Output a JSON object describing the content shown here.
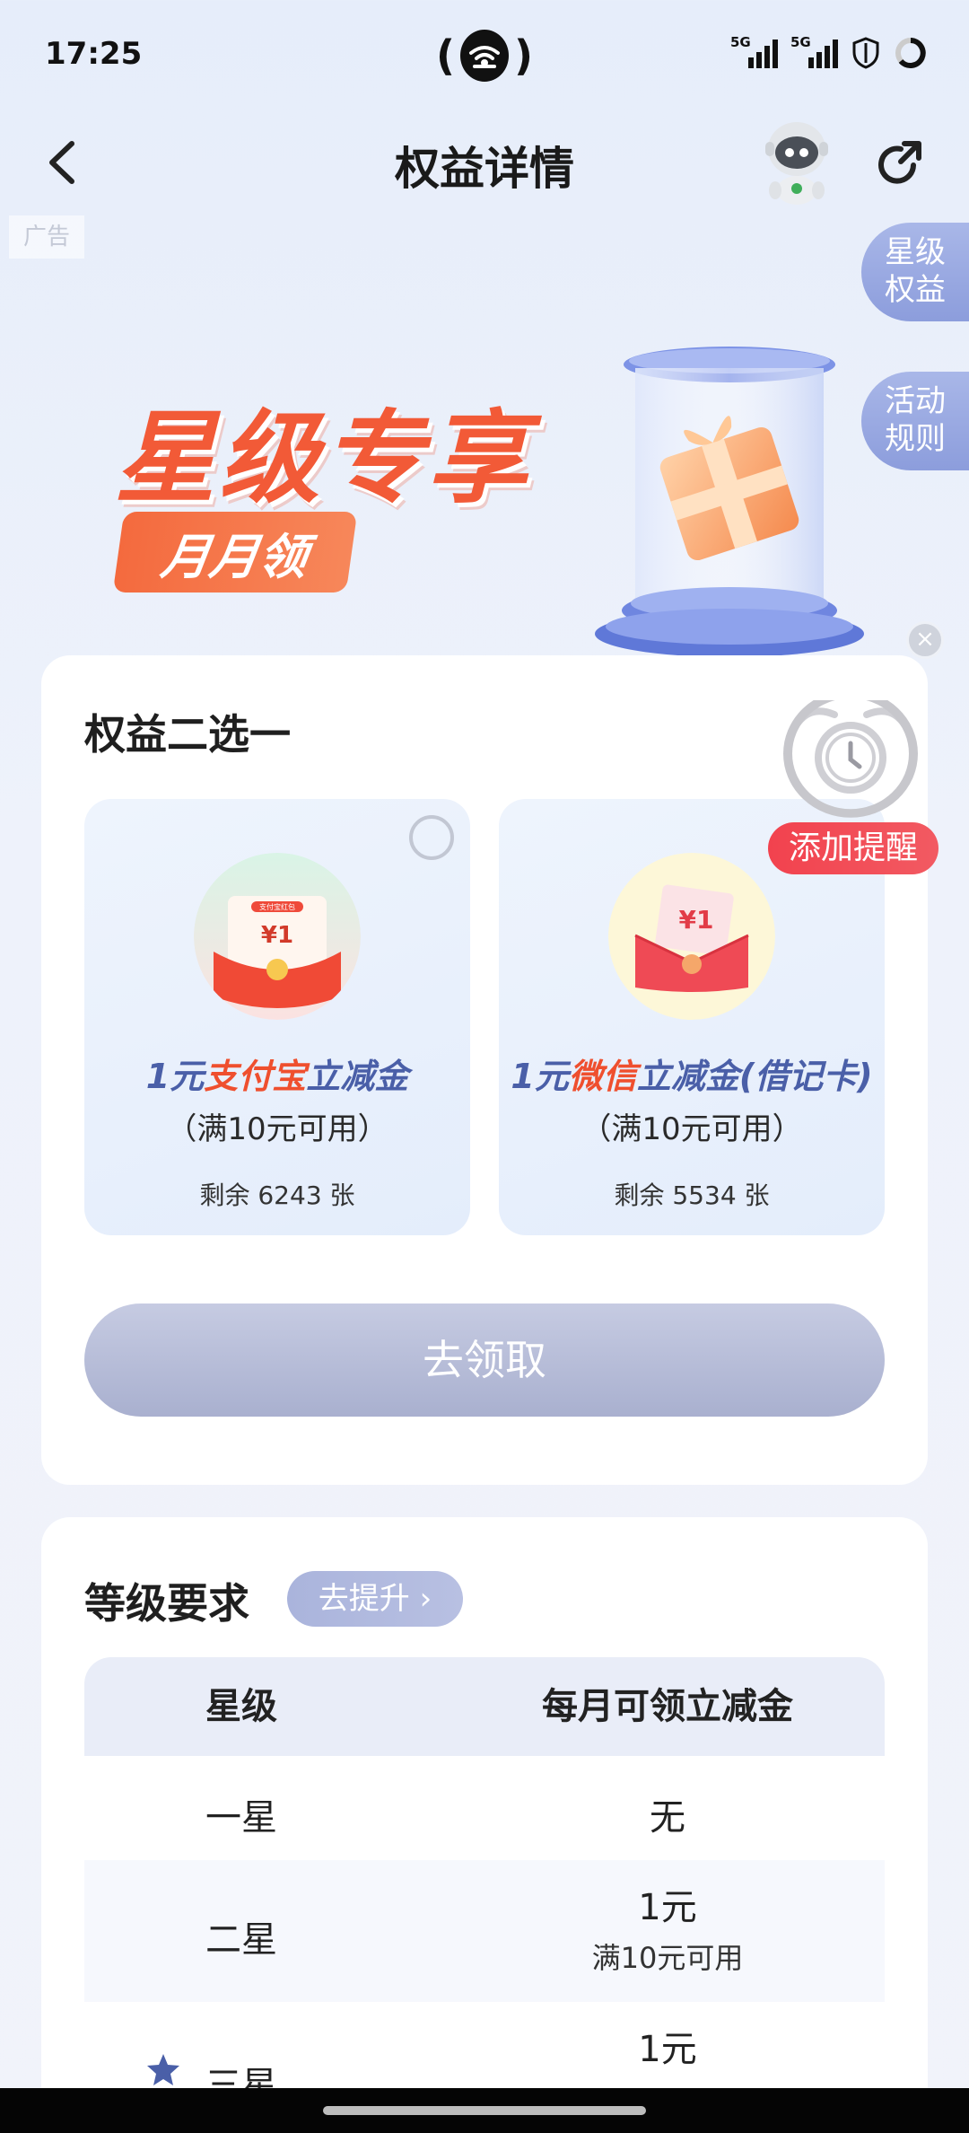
{
  "status_bar": {
    "time": "17:25",
    "signal1_label": "5G",
    "signal2_label": "5G",
    "icons": [
      "hotspot-icon",
      "signal-icon",
      "signal-icon",
      "shield-icon",
      "battery-ring-icon"
    ]
  },
  "header": {
    "title": "权益详情",
    "ad_label": "广告"
  },
  "side_tabs": {
    "star_benefits": "星级\n权益",
    "star_benefits_l1": "星级",
    "star_benefits_l2": "权益",
    "rules_l1": "活动",
    "rules_l2": "规则"
  },
  "banner": {
    "title": "星级专享",
    "pill": "月月领"
  },
  "choice": {
    "title": "权益二选一",
    "options": [
      {
        "name_prefix": "1元",
        "name_brand": "支付宝",
        "name_suffix": "立减金",
        "condition": "（满10元可用）",
        "remaining": "剩余 6243 张",
        "icon_small_text": "支付宝红包",
        "icon_amount": "¥1"
      },
      {
        "name_prefix": "1元",
        "name_brand": "微信",
        "name_suffix": "立减金(借记卡)",
        "condition": "（满10元可用）",
        "remaining": "剩余 5534 张",
        "icon_amount": "¥1"
      }
    ],
    "claim_button": "去领取",
    "reminder_label": "添加提醒"
  },
  "level": {
    "title": "等级要求",
    "upgrade_button": "去提升",
    "table": {
      "headers": [
        "星级",
        "每月可领立减金"
      ],
      "rows": [
        {
          "level": "一星",
          "amount": "无",
          "condition": ""
        },
        {
          "level": "二星",
          "amount": "1元",
          "condition": "满10元可用"
        },
        {
          "level": "三星",
          "amount": "1元",
          "condition": ""
        }
      ]
    }
  },
  "colors": {
    "accent_orange": "#f25a37",
    "accent_blue": "#4a5fa8",
    "side_tab": "#8c9ddc",
    "reminder_red": "#f2424e",
    "button_disabled": "#a9b0cf"
  }
}
